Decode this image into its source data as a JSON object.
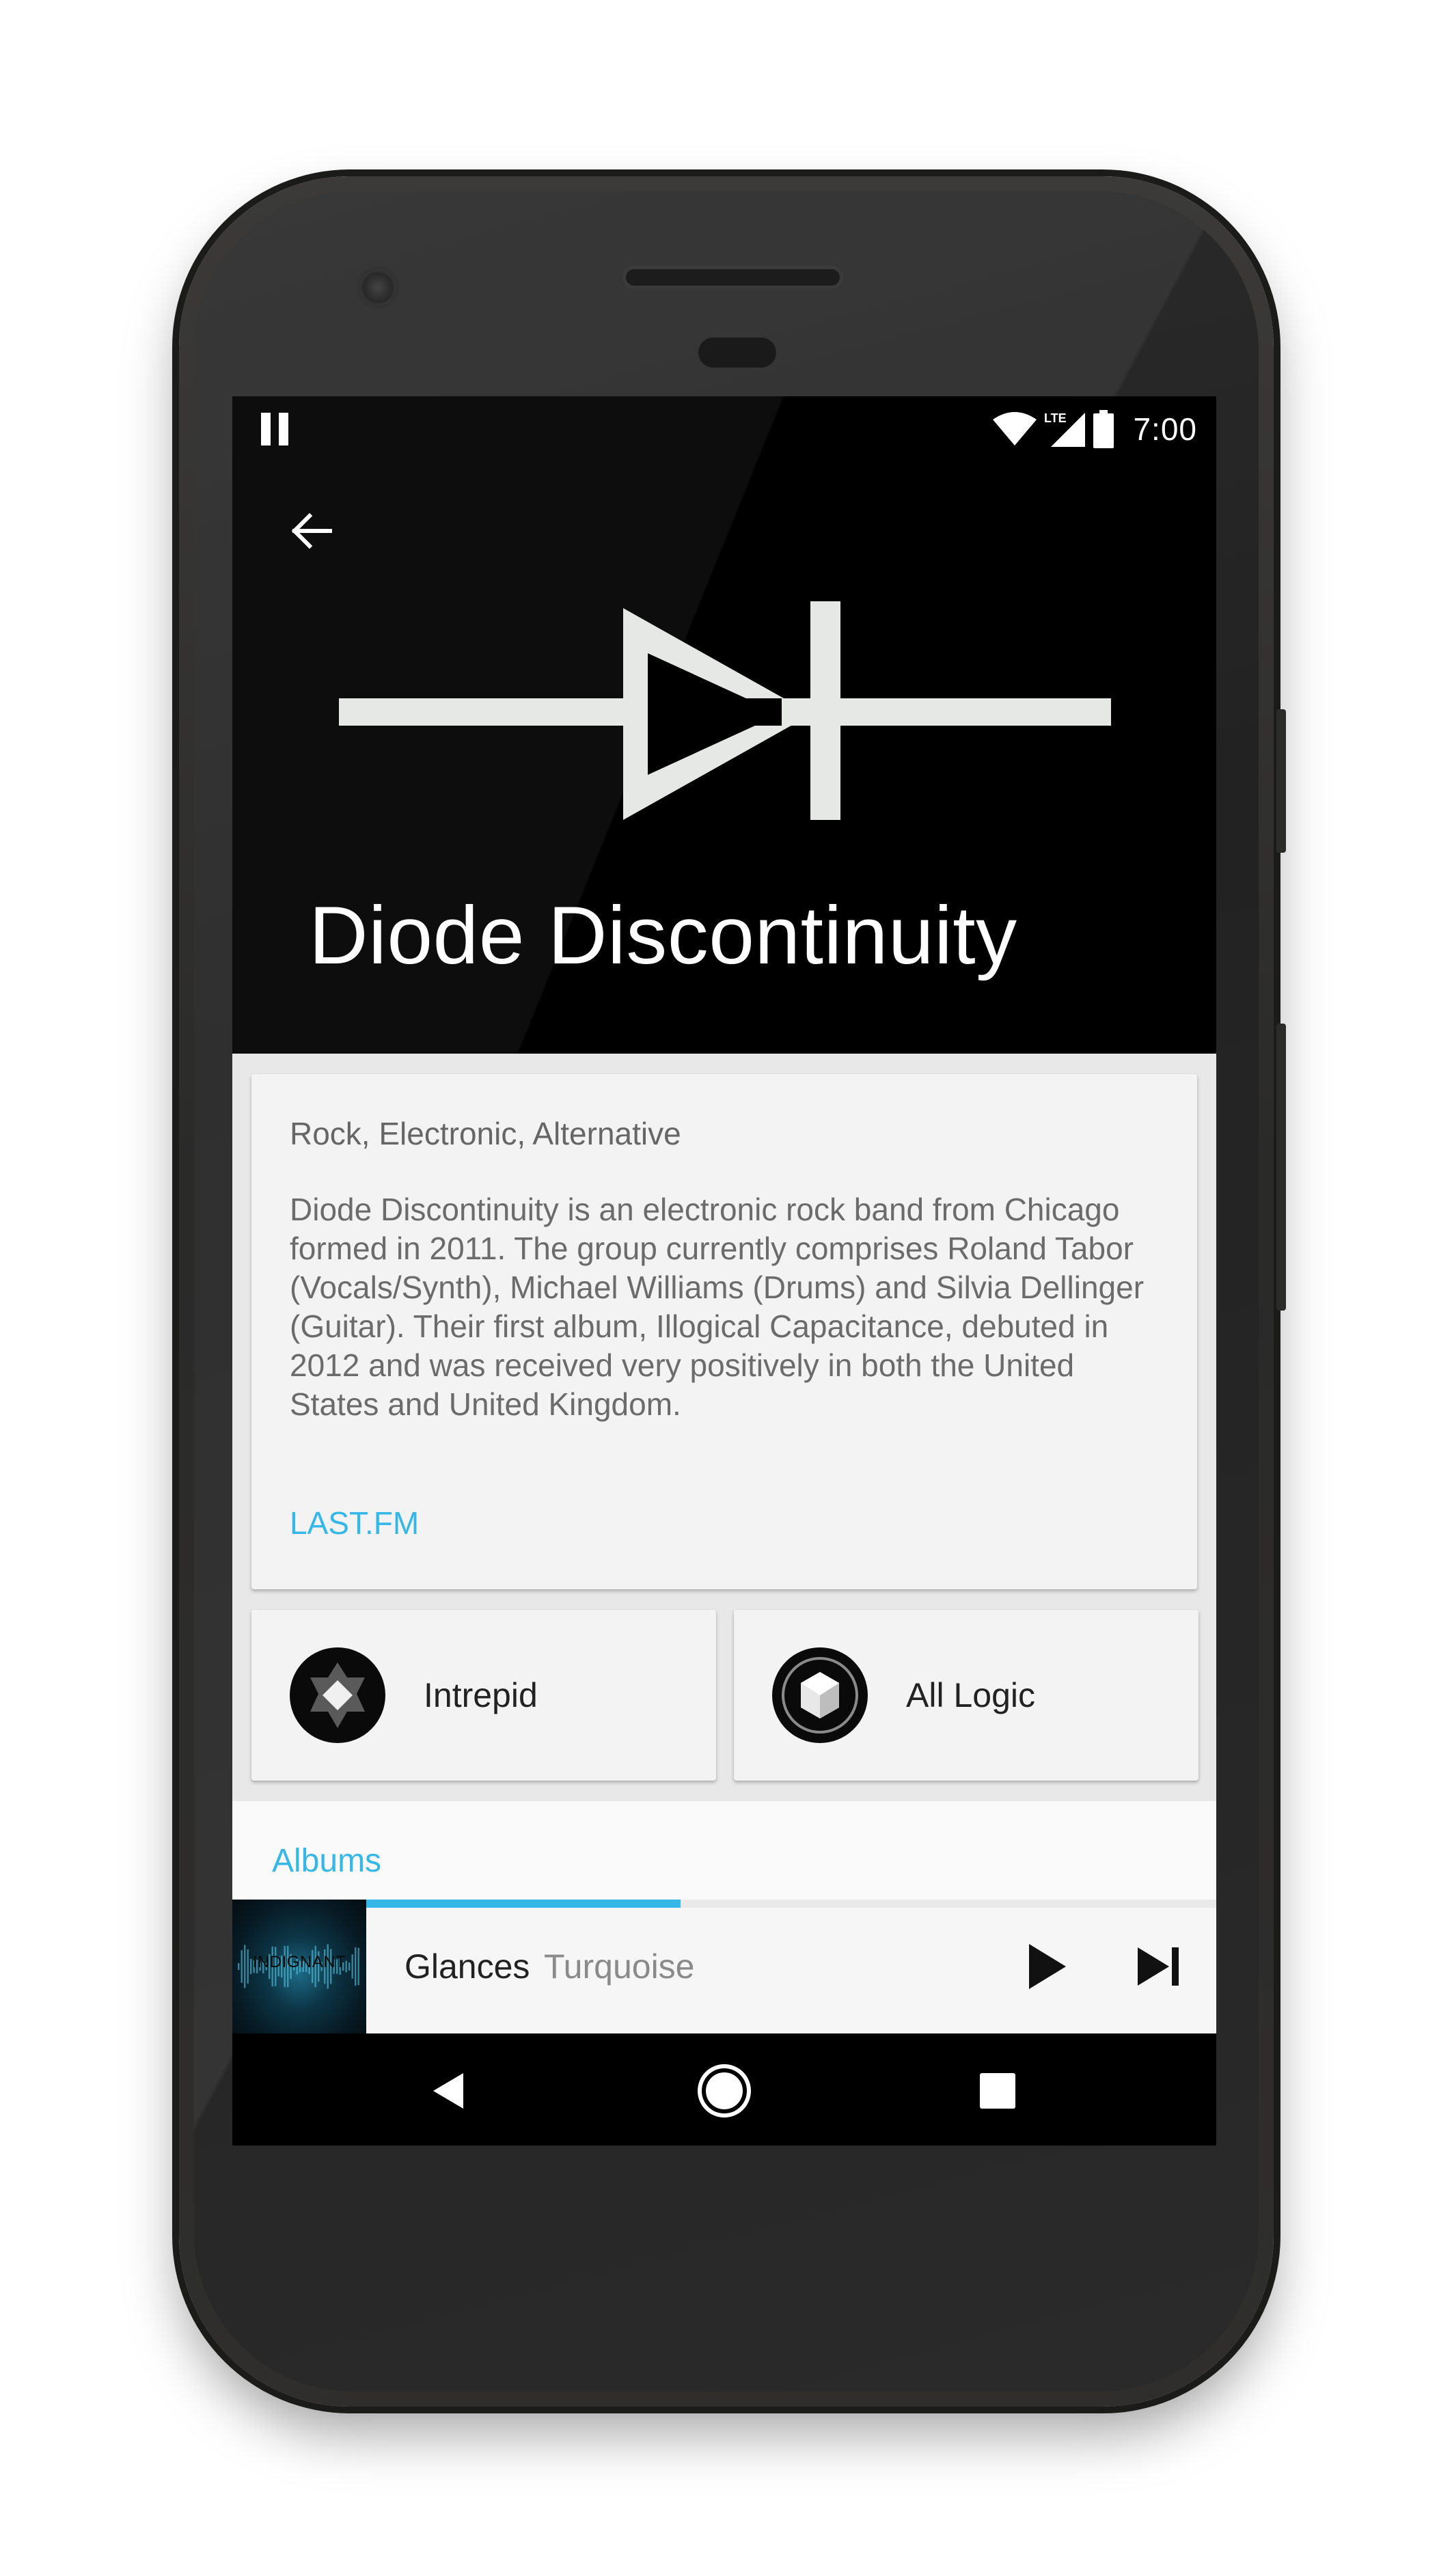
{
  "status_bar": {
    "time": "7:00",
    "icons": [
      "pause-icon",
      "wifi-icon",
      "lte-signal-icon",
      "battery-icon"
    ],
    "network_label": "LTE"
  },
  "app_bar": {
    "back_icon": "arrow-back-icon"
  },
  "artist": {
    "name": "Diode Discontinuity",
    "logo": "diode-symbol"
  },
  "bio_card": {
    "genres": "Rock, Electronic, Alternative",
    "bio": "Diode Discontinuity is an electronic rock band from Chicago formed in 2011. The group currently comprises Roland Tabor (Vocals/Synth), Michael Williams (Drums) and Silvia Dellinger (Guitar). Their first album, Illogical Capacitance, debuted in 2012 and was received very positively in both the United States and United Kingdom.",
    "link_label": "LAST.FM"
  },
  "similar_artists": [
    {
      "name": "Intrepid",
      "avatar_icon": "intrepid-logo"
    },
    {
      "name": "All Logic",
      "avatar_icon": "all-logic-logo"
    }
  ],
  "albums_section": {
    "label": "Albums"
  },
  "now_playing": {
    "track": "Glances",
    "artist": "Turquoise",
    "album_art_text": "INDIGNANT",
    "progress": 0.37,
    "play_icon": "play-icon",
    "next_icon": "skip-next-icon"
  },
  "nav_bar": {
    "icons": [
      "nav-back-icon",
      "nav-home-icon",
      "nav-recents-icon"
    ]
  },
  "colors": {
    "accent": "#35b7e8",
    "hero_bg": "#000000",
    "card_bg": "#f3f3f3",
    "now_playing_bg": "#f6f6f6"
  }
}
